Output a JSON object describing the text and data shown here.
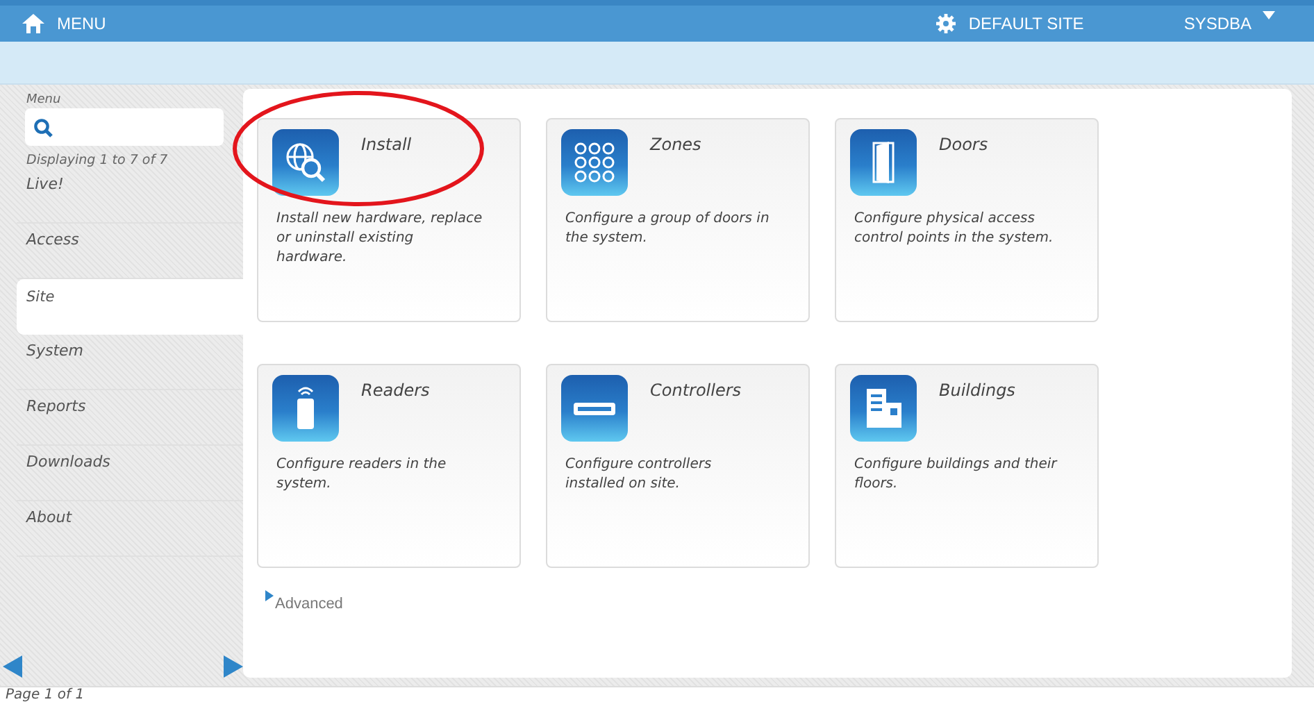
{
  "topbar": {
    "menu": "MENU",
    "site": "DEFAULT SITE",
    "user": "SYSDBA"
  },
  "sidebar": {
    "title": "Menu",
    "count": "Displaying 1 to 7 of 7",
    "items": [
      {
        "label": "Live!",
        "selected": false
      },
      {
        "label": "Access",
        "selected": false
      },
      {
        "label": "Site",
        "selected": true
      },
      {
        "label": "System",
        "selected": false
      },
      {
        "label": "Reports",
        "selected": false
      },
      {
        "label": "Downloads",
        "selected": false
      },
      {
        "label": "About",
        "selected": false
      }
    ],
    "pager": "Page 1 of 1"
  },
  "tiles": [
    {
      "kind": "install",
      "title": "Install",
      "description": "Install new hardware, replace or uninstall existing hardware.",
      "highlighted": true
    },
    {
      "kind": "zones",
      "title": "Zones",
      "description": "Configure a group of doors in the system.",
      "highlighted": false
    },
    {
      "kind": "doors",
      "title": "Doors",
      "description": "Configure physical access control points in the system.",
      "highlighted": false
    },
    {
      "kind": "readers",
      "title": "Readers",
      "description": "Configure readers in the system.",
      "highlighted": false
    },
    {
      "kind": "controllers",
      "title": "Controllers",
      "description": "Configure controllers installed on site.",
      "highlighted": false
    },
    {
      "kind": "buildings",
      "title": "Buildings",
      "description": "Configure buildings and their floors.",
      "highlighted": false
    }
  ],
  "advanced": "Advanced"
}
